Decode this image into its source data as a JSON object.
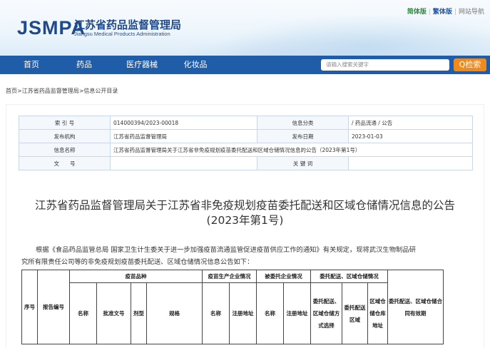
{
  "header": {
    "logo": "JSMPA",
    "site_title": "江苏省药品监督管理局",
    "site_subtitle": "Jiangsu Medical Products Administration",
    "top_links": [
      "简体版",
      "繁体版",
      "网站导航"
    ]
  },
  "nav": {
    "items": [
      "首页",
      "药品",
      "医疗器械",
      "化妆品"
    ],
    "search_placeholder": "请输入搜索关键字",
    "search_button": "Q检索"
  },
  "breadcrumb": "首页>江苏省药品监督管理局>信息公开目录",
  "meta": {
    "rows": [
      [
        "索 引 号",
        "014000394/2023-00018",
        "信息分类",
        "/  药品流通  /  公告"
      ],
      [
        "发布机构",
        "江苏省药品监督管理局",
        "发布日期",
        "2023-01-03"
      ],
      [
        "信息名称",
        "江苏省药品监督管理局关于江苏省非免疫规划疫苗委托配送和区域仓储情况信息的公告（2023年第1号）"
      ],
      [
        "文　　号",
        "",
        "关 键 词",
        ""
      ]
    ]
  },
  "article": {
    "title_line1": "江苏省药品监督管理局关于江苏省非免疫规划疫苗委托配送和区域仓储情况信息的公告",
    "title_line2": "(2023年第1号)",
    "para_line1": "根据《食品药品监管总局 国家卫生计生委关于进一步加强疫苗流通监管促进疫苗供应工作的通知》有关规定，现将武汉生物制品研",
    "para_line2": "究所有限责任公司等的非免疫规划疫苗委托配送、区域仓储情况信息公告如下："
  },
  "table": {
    "h_seq": "序号",
    "h_report": "报告编号",
    "g_vaccine": "疫苗品种",
    "g_producer": "疫苗生产企业情况",
    "g_consignee": "被委托企业情况",
    "g_delivery": "委托配送、区域仓储情况",
    "h_validity": "委托配送、区域仓储合同有效期",
    "h_name": "名称",
    "h_approval": "批准文号",
    "h_form": "剂型",
    "h_spec": "规格",
    "h_pname": "名称",
    "h_paddr": "注册地址",
    "h_cname": "名称",
    "h_caddr": "注册地址",
    "h_method": "委托配送、区域仓储方式选择",
    "h_area": "委托配送区域",
    "h_warehouse": "区域仓储仓库地址"
  }
}
